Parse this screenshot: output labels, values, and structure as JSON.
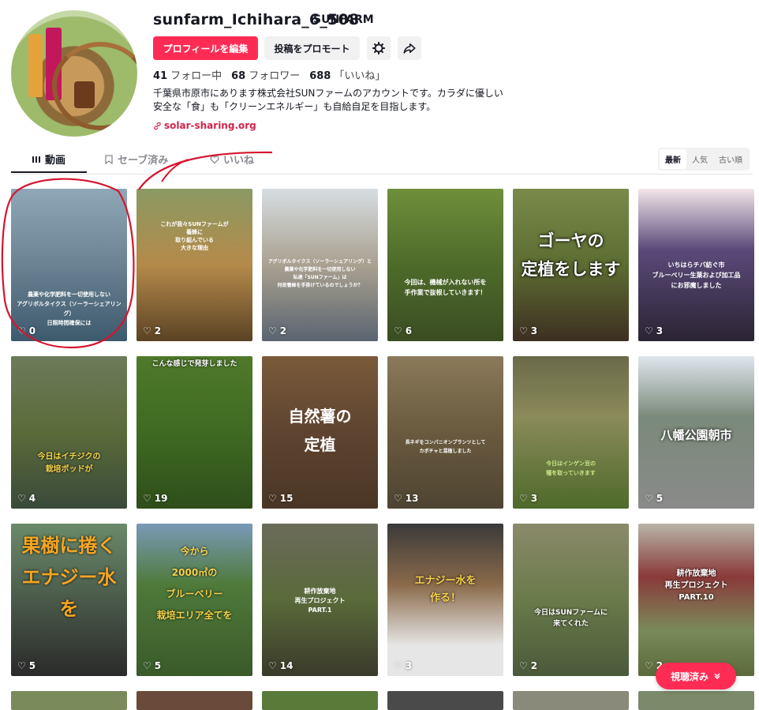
{
  "profile": {
    "username": "sunfarm_Ichihara_6_508",
    "nickname": "SUNFARM",
    "edit_label": "プロフィールを編集",
    "promote_label": "投稿をプロモート",
    "stats": [
      {
        "value": "41",
        "label": "フォロー中"
      },
      {
        "value": "68",
        "label": "フォロワー"
      },
      {
        "value": "688",
        "label": "「いいね」"
      }
    ],
    "bio_lines": [
      "千葉県市原市にあります株式会社SUNファームのアカウントです。カラダに優しい",
      "安全な「食」も「クリーンエネルギー」も自給自足を目指します。"
    ],
    "link": "solar-sharing.org"
  },
  "tabs": {
    "videos": "動画",
    "saved": "セーブ済み",
    "liked": "いいね",
    "sort": [
      "最新",
      "人気",
      "古い順"
    ]
  },
  "videos": [
    {
      "overlay": "農薬や化学肥料を一切使用しない\nアグリボルタイクス（ソーラーシェアリング）\n日照時間確保には",
      "views": "0"
    },
    {
      "overlay": "これが我々SUNファームが\n養蜂に\n取り組んでいる\n大きな理由",
      "views": "2"
    },
    {
      "overlay": "アグリボルタイクス（ソーラーシェアリング）と\n農薬や化学肥料を一切使用しない\n私達「SUNファーム」は\n何故養蜂を手掛けているのでしょうか？",
      "views": "2"
    },
    {
      "overlay": "今回は、機械が入れない所を\n手作業で抜根していきます！",
      "views": "6"
    },
    {
      "overlay": "ゴーヤの\n定植をします",
      "views": "3"
    },
    {
      "overlay": "いちはらチバ紡ぐ市\nブルーベリー生葉および加工品\nにお邪魔しました",
      "views": "3"
    },
    {
      "overlay": "今日はイチジクの\n栽培ポッドが",
      "views": "4"
    },
    {
      "overlay": "こんな感じで発芽しました",
      "views": "19"
    },
    {
      "overlay": "自然薯の\n定植",
      "views": "15"
    },
    {
      "overlay": "長ネギをコンパニオンプランツとして\nカボチャと混植しました",
      "views": "13"
    },
    {
      "overlay": "今日はインゲン豆の\n種を取っていきます",
      "views": "3"
    },
    {
      "overlay": "八幡公園朝市",
      "views": "5"
    },
    {
      "overlay": "果樹に捲く\nエナジー水を",
      "views": "5"
    },
    {
      "overlay": "今から\n2000㎡の\nブルーベリー\n栽培エリア全てを",
      "views": "5"
    },
    {
      "overlay": "耕作放棄地\n再生プロジェクト\nPART.1",
      "views": "14"
    },
    {
      "overlay": "エナジー水を\n作る！",
      "views": "3"
    },
    {
      "overlay": "今日はSUNファームに\n来てくれた",
      "views": "2"
    },
    {
      "overlay": "耕作放棄地\n再生プロジェクト\nPART.10",
      "views": "2"
    }
  ],
  "watched_label": "視聴済み",
  "colors": {
    "accent": "#fe2c55",
    "annotation": "#d6142f"
  }
}
